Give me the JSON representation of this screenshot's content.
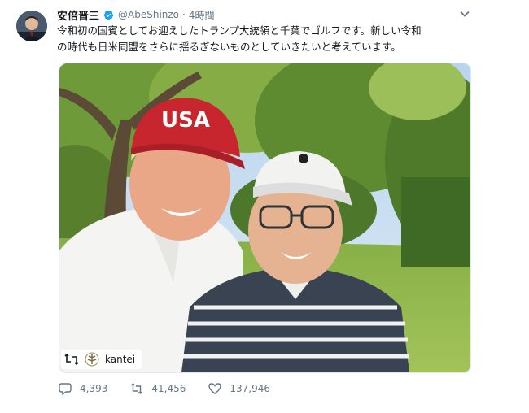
{
  "tweet": {
    "display_name": "安倍晋三",
    "handle": "@AbeShinzo",
    "separator": "·",
    "time": "4時間",
    "text_line1": "令和初の国賓としてお迎えしたトランプ大統領と千葉でゴルフです。新しい令和",
    "text_line2": "の時代も日米同盟をさらに揺るぎないものとしていきたいと考えています。",
    "photo_cap_text": "USA",
    "repost_badge_label": "kantei",
    "replies": "4,393",
    "retweets": "41,456",
    "likes": "137,946"
  },
  "colors": {
    "verified": "#1da1f2",
    "muted": "#657786",
    "cap_red": "#c8262f"
  },
  "icons": [
    "verified-badge-icon",
    "chevron-down-icon",
    "reply-icon",
    "retweet-icon",
    "like-icon",
    "repost-icon"
  ]
}
